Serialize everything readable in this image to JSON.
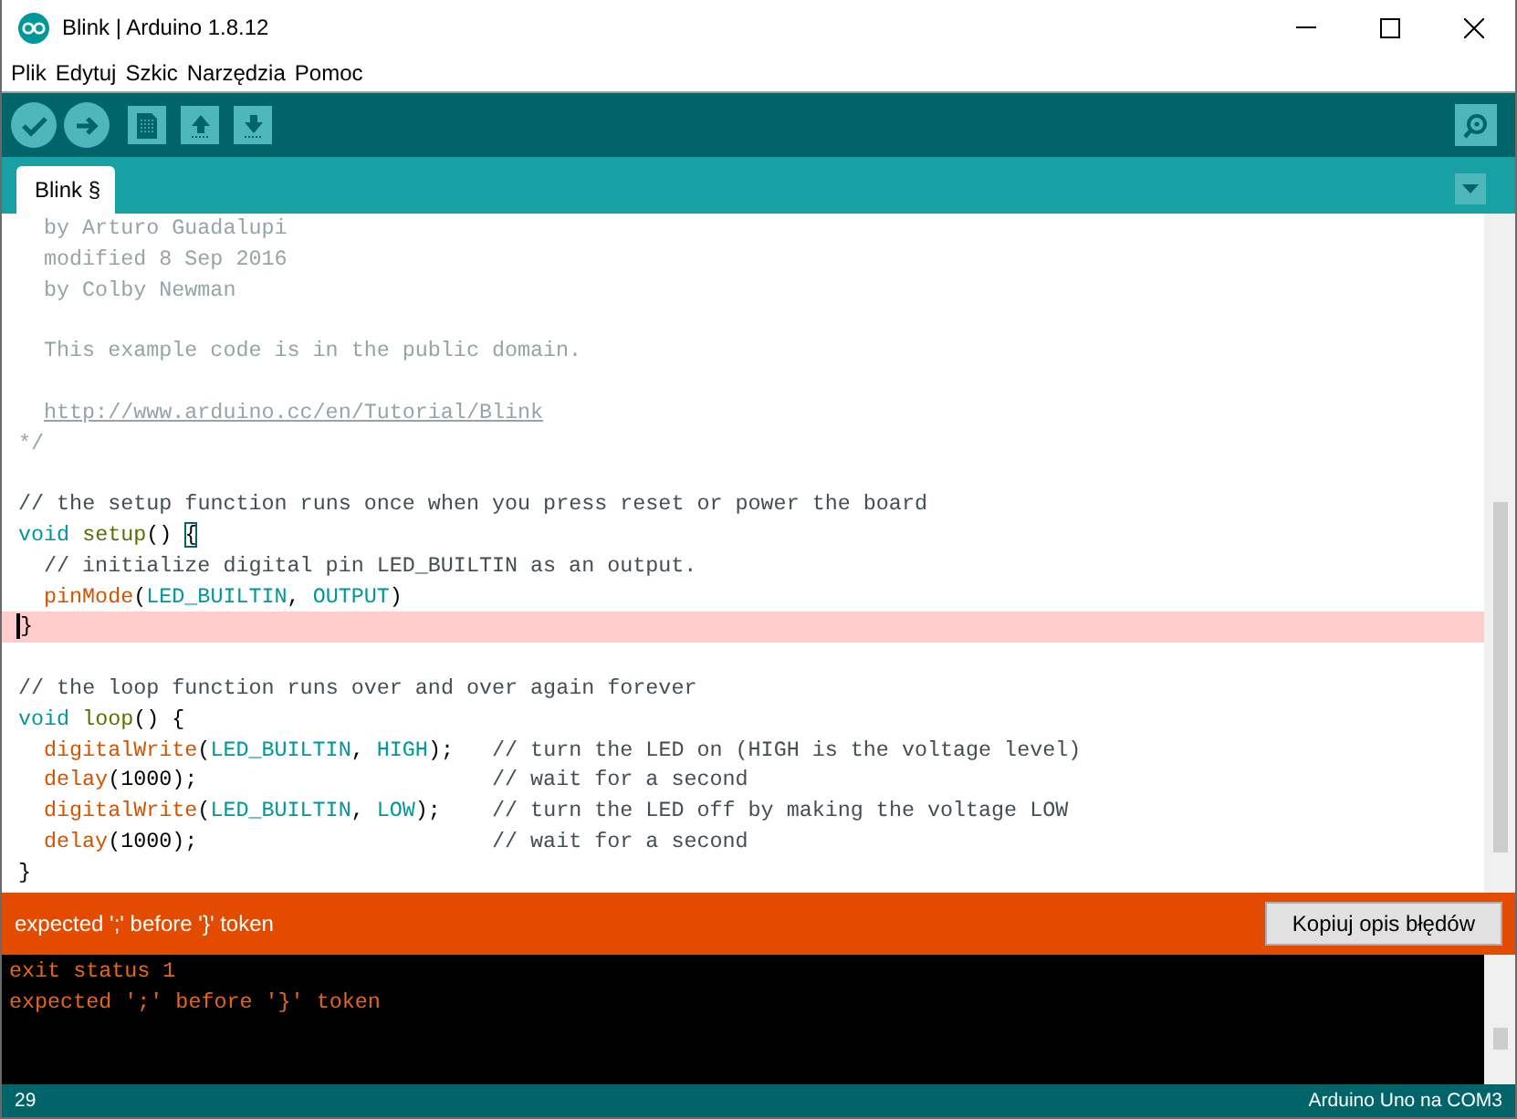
{
  "window": {
    "title": "Blink | Arduino 1.8.12"
  },
  "menu": [
    {
      "label": "Plik"
    },
    {
      "label": "Edytuj"
    },
    {
      "label": "Szkic"
    },
    {
      "label": "Narzędzia"
    },
    {
      "label": "Pomoc"
    }
  ],
  "toolbar": {
    "buttons": [
      {
        "kind": "verify"
      },
      {
        "kind": "upload"
      },
      {
        "kind": "new"
      },
      {
        "kind": "open"
      },
      {
        "kind": "save"
      }
    ],
    "right_button": {
      "kind": "serial-monitor"
    }
  },
  "tabs": [
    {
      "label": "Blink §",
      "selected": true
    }
  ],
  "editor": {
    "lines": [
      {
        "kind": "code",
        "highlighted": false,
        "caret": false,
        "indented": true,
        "tokens": [
          {
            "kind": "comment",
            "text": "by Arturo Guadalupi"
          }
        ]
      },
      {
        "kind": "code",
        "highlighted": false,
        "caret": false,
        "indented": true,
        "tokens": [
          {
            "kind": "comment",
            "text": "modified 8 Sep 2016"
          }
        ]
      },
      {
        "kind": "code",
        "highlighted": false,
        "caret": false,
        "indented": true,
        "tokens": [
          {
            "kind": "comment",
            "text": "by Colby Newman"
          }
        ]
      },
      {
        "kind": "blank"
      },
      {
        "kind": "code",
        "highlighted": false,
        "caret": false,
        "indented": true,
        "tokens": [
          {
            "kind": "comment",
            "text": "This example code is in the public domain."
          }
        ]
      },
      {
        "kind": "blank"
      },
      {
        "kind": "code",
        "highlighted": false,
        "caret": false,
        "indented": true,
        "tokens": [
          {
            "kind": "link",
            "text": "http://www.arduino.cc/en/Tutorial/Blink"
          }
        ]
      },
      {
        "kind": "code",
        "highlighted": false,
        "caret": false,
        "indented": false,
        "tokens": [
          {
            "kind": "comment",
            "text": "*/"
          }
        ]
      },
      {
        "kind": "blank"
      },
      {
        "kind": "code",
        "highlighted": false,
        "caret": false,
        "indented": false,
        "tokens": [
          {
            "kind": "line-comment",
            "text": "// the setup function runs once when you press reset or power the board"
          }
        ]
      },
      {
        "kind": "code",
        "highlighted": false,
        "caret": false,
        "indented": false,
        "tokens": [
          {
            "kind": "keyword",
            "text": "void "
          },
          {
            "kind": "structure",
            "text": "setup"
          },
          {
            "kind": "plain",
            "text": "() "
          },
          {
            "kind": "brace-match",
            "text": "{"
          }
        ]
      },
      {
        "kind": "code",
        "highlighted": false,
        "caret": false,
        "indented": true,
        "tokens": [
          {
            "kind": "line-comment",
            "text": "// initialize digital pin LED_BUILTIN as an output."
          }
        ]
      },
      {
        "kind": "code",
        "highlighted": false,
        "caret": false,
        "indented": true,
        "tokens": [
          {
            "kind": "function",
            "text": "pinMode"
          },
          {
            "kind": "plain",
            "text": "("
          },
          {
            "kind": "constant",
            "text": "LED_BUILTIN"
          },
          {
            "kind": "plain",
            "text": ", "
          },
          {
            "kind": "constant",
            "text": "OUTPUT"
          },
          {
            "kind": "plain",
            "text": ")"
          }
        ]
      },
      {
        "kind": "code",
        "highlighted": true,
        "caret": true,
        "indented": false,
        "tokens": [
          {
            "kind": "plain",
            "text": "}"
          }
        ]
      },
      {
        "kind": "blank"
      },
      {
        "kind": "code",
        "highlighted": false,
        "caret": false,
        "indented": false,
        "tokens": [
          {
            "kind": "line-comment",
            "text": "// the loop function runs over and over again forever"
          }
        ]
      },
      {
        "kind": "code",
        "highlighted": false,
        "caret": false,
        "indented": false,
        "tokens": [
          {
            "kind": "keyword",
            "text": "void "
          },
          {
            "kind": "structure",
            "text": "loop"
          },
          {
            "kind": "plain",
            "text": "() {"
          }
        ]
      },
      {
        "kind": "code",
        "highlighted": false,
        "caret": false,
        "indented": true,
        "tokens": [
          {
            "kind": "function",
            "text": "digitalWrite"
          },
          {
            "kind": "plain",
            "text": "("
          },
          {
            "kind": "constant",
            "text": "LED_BUILTIN"
          },
          {
            "kind": "plain",
            "text": ", "
          },
          {
            "kind": "constant",
            "text": "HIGH"
          },
          {
            "kind": "plain",
            "text": ");   "
          },
          {
            "kind": "line-comment",
            "text": "// turn the LED on (HIGH is the voltage level)"
          }
        ]
      },
      {
        "kind": "code",
        "highlighted": false,
        "caret": false,
        "indented": true,
        "tokens": [
          {
            "kind": "function",
            "text": "delay"
          },
          {
            "kind": "plain",
            "text": "(1000);                       "
          },
          {
            "kind": "line-comment",
            "text": "// wait for a second"
          }
        ]
      },
      {
        "kind": "code",
        "highlighted": false,
        "caret": false,
        "indented": true,
        "tokens": [
          {
            "kind": "function",
            "text": "digitalWrite"
          },
          {
            "kind": "plain",
            "text": "("
          },
          {
            "kind": "constant",
            "text": "LED_BUILTIN"
          },
          {
            "kind": "plain",
            "text": ", "
          },
          {
            "kind": "constant",
            "text": "LOW"
          },
          {
            "kind": "plain",
            "text": ");    "
          },
          {
            "kind": "line-comment",
            "text": "// turn the LED off by making the voltage LOW"
          }
        ]
      },
      {
        "kind": "code",
        "highlighted": false,
        "caret": false,
        "indented": true,
        "tokens": [
          {
            "kind": "function",
            "text": "delay"
          },
          {
            "kind": "plain",
            "text": "(1000);                       "
          },
          {
            "kind": "line-comment",
            "text": "// wait for a second"
          }
        ]
      },
      {
        "kind": "code",
        "highlighted": false,
        "caret": false,
        "indented": false,
        "tokens": [
          {
            "kind": "plain",
            "text": "}"
          }
        ]
      }
    ]
  },
  "error_bar": {
    "message": "expected ';' before '}' token",
    "button": "Kopiuj opis błędów"
  },
  "console": {
    "lines": [
      "exit status 1",
      "expected ';' before '}' token"
    ]
  },
  "status_bar": {
    "line": "29",
    "board": "Arduino Uno na COM3"
  }
}
